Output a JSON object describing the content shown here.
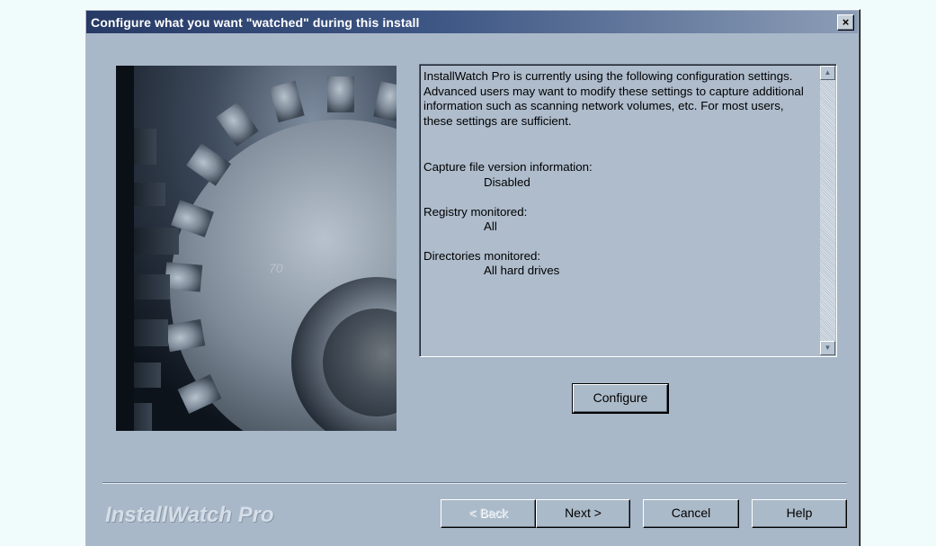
{
  "window": {
    "title": "Configure what you want \"watched\" during this install",
    "close_label": "×"
  },
  "info": {
    "intro": "InstallWatch Pro is currently using the following configuration settings.  Advanced users may want to modify these settings to capture additional information such as scanning network volumes, etc.  For most users, these settings are sufficient.",
    "settings": [
      {
        "label": "Capture file version information:",
        "value": "Disabled"
      },
      {
        "label": "Registry monitored:",
        "value": "All"
      },
      {
        "label": "Directories monitored:",
        "value": "All hard drives"
      }
    ],
    "scroll_up_icon": "▲",
    "scroll_down_icon": "▼"
  },
  "buttons": {
    "configure": "Configure",
    "back": "< Back",
    "next": "Next >",
    "cancel": "Cancel",
    "help": "Help"
  },
  "branding": {
    "product_name": "InstallWatch Pro"
  },
  "colors": {
    "dialog_bg": "#a9b8c8",
    "titlebar_start": "#273a66",
    "titlebar_end": "#8c9db6"
  }
}
